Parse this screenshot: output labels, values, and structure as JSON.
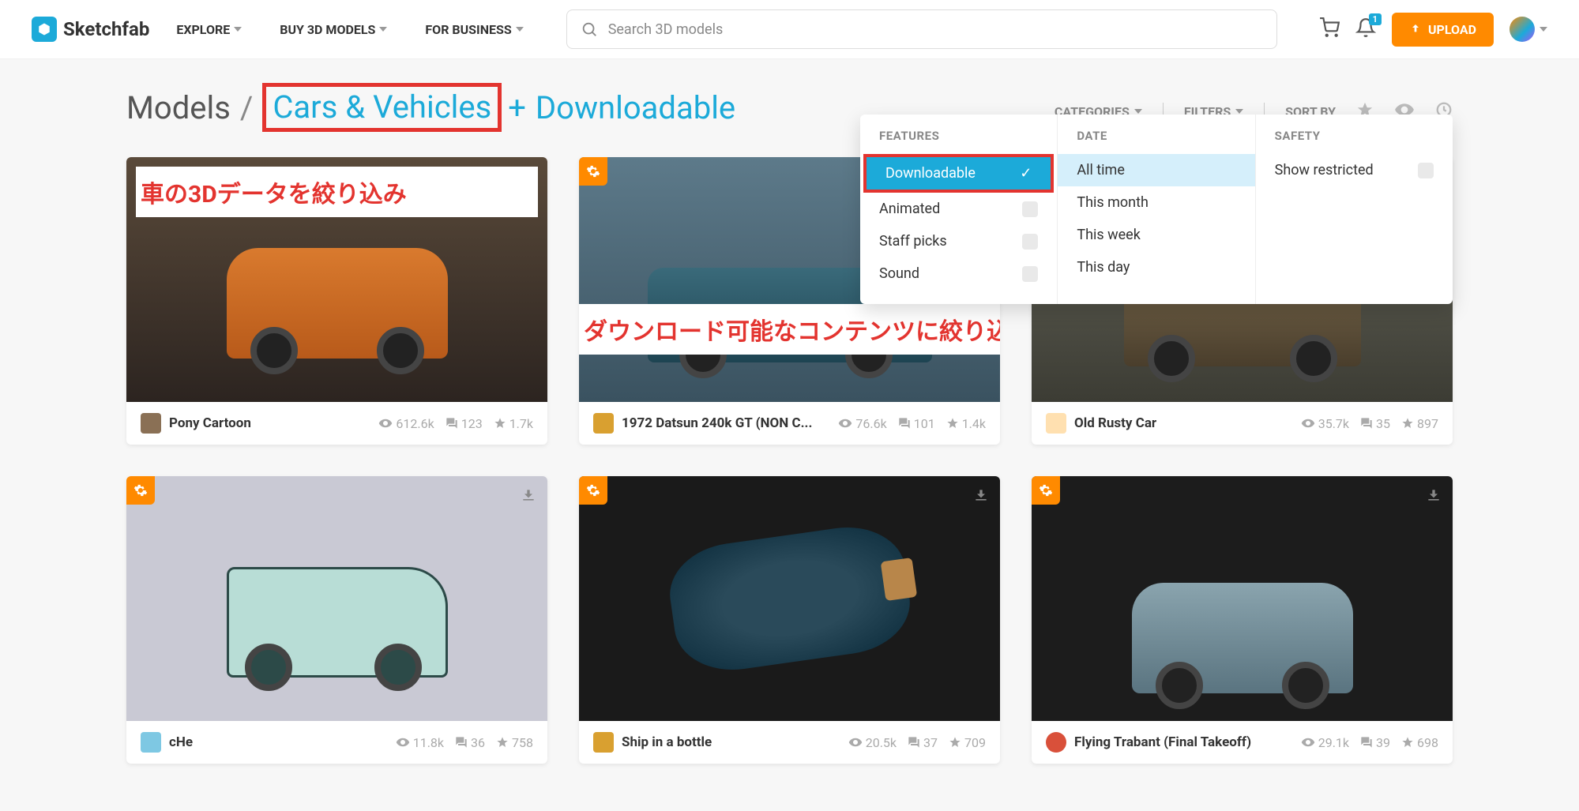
{
  "header": {
    "brand": "Sketchfab",
    "nav": [
      "EXPLORE",
      "BUY 3D MODELS",
      "FOR BUSINESS"
    ],
    "search_placeholder": "Search 3D models",
    "notification_badge": "1",
    "upload_label": "UPLOAD"
  },
  "breadcrumb": {
    "root": "Models",
    "category": "Cars & Vehicles",
    "plus": "+",
    "tail": "Downloadable"
  },
  "toolbar": {
    "categories": "CATEGORIES",
    "filters": "FILTERS",
    "sort": "SORT BY"
  },
  "filters": {
    "features": {
      "heading": "FEATURES",
      "items": [
        {
          "label": "Downloadable",
          "selected": true
        },
        {
          "label": "Animated",
          "selected": false
        },
        {
          "label": "Staff picks",
          "selected": false
        },
        {
          "label": "Sound",
          "selected": false
        }
      ]
    },
    "date": {
      "heading": "DATE",
      "items": [
        {
          "label": "All time",
          "highlighted": true
        },
        {
          "label": "This month"
        },
        {
          "label": "This week"
        },
        {
          "label": "This day"
        }
      ]
    },
    "safety": {
      "heading": "SAFETY",
      "items": [
        {
          "label": "Show restricted"
        }
      ]
    }
  },
  "annotations": {
    "a1": "車の3Dデータを絞り込み",
    "a2": "ダウンロード可能なコンテンツに絞り込み"
  },
  "cards": [
    {
      "title": "Pony Cartoon",
      "views": "612.6k",
      "comments": "123",
      "likes": "1.7k"
    },
    {
      "title": "1972 Datsun 240k GT (NON C...",
      "views": "76.6k",
      "comments": "101",
      "likes": "1.4k"
    },
    {
      "title": "Old Rusty Car",
      "views": "35.7k",
      "comments": "35",
      "likes": "897"
    },
    {
      "title": "cHe",
      "views": "11.8k",
      "comments": "36",
      "likes": "758"
    },
    {
      "title": "Ship in a bottle",
      "views": "20.5k",
      "comments": "37",
      "likes": "709"
    },
    {
      "title": "Flying Trabant (Final Takeoff)",
      "views": "29.1k",
      "comments": "39",
      "likes": "698"
    }
  ]
}
